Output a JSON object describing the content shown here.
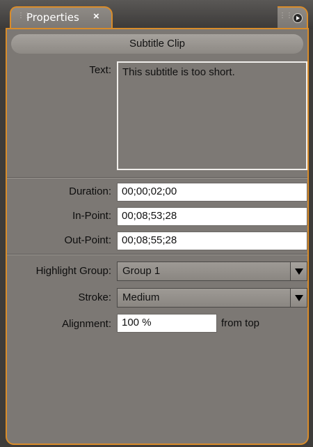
{
  "tab": {
    "title": "Properties",
    "close_glyph": "×"
  },
  "panel_menu_icon": "flyout-menu-icon",
  "header": {
    "title": "Subtitle Clip"
  },
  "text": {
    "label": "Text:",
    "value": "This subtitle is too short."
  },
  "duration": {
    "label": "Duration:",
    "value": "00;00;02;00"
  },
  "in_point": {
    "label": "In-Point:",
    "value": "00;08;53;28"
  },
  "out_point": {
    "label": "Out-Point:",
    "value": "00;08;55;28"
  },
  "highlight_group": {
    "label": "Highlight Group:",
    "value": "Group 1"
  },
  "stroke": {
    "label": "Stroke:",
    "value": "Medium"
  },
  "alignment": {
    "label": "Alignment:",
    "value": "100 %",
    "suffix": "from top"
  },
  "colors": {
    "accent_border": "#d98c2a",
    "panel_bg": "#7c7874",
    "field_bg": "#ffffff"
  }
}
